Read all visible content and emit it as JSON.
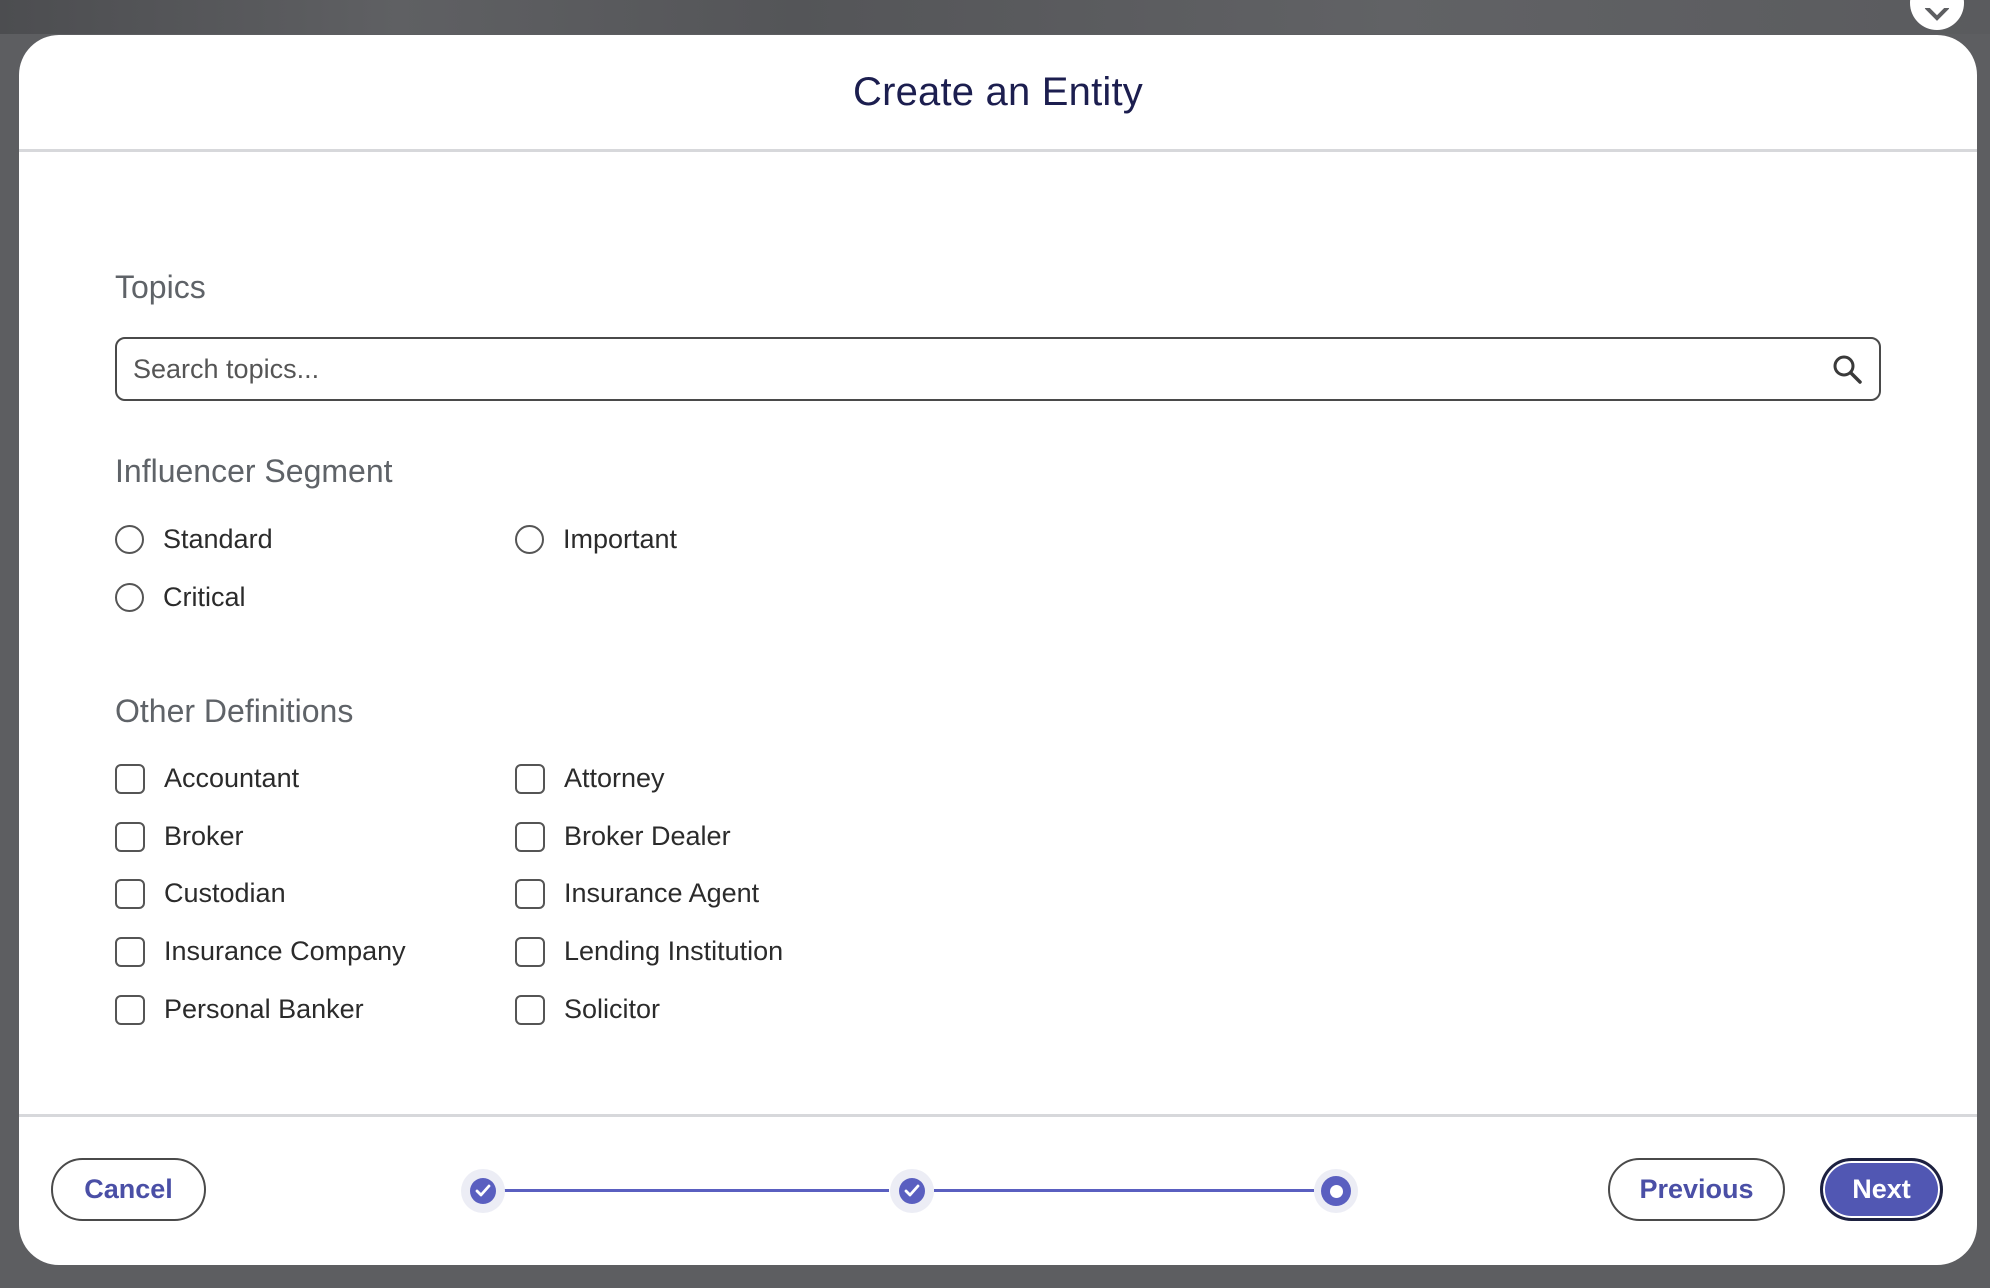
{
  "modal": {
    "title": "Create an Entity"
  },
  "topics": {
    "title": "Topics",
    "search_placeholder": "Search topics...",
    "search_value": ""
  },
  "influencer_segment": {
    "title": "Influencer Segment",
    "options": [
      {
        "label": "Standard",
        "selected": false
      },
      {
        "label": "Important",
        "selected": false
      },
      {
        "label": "Critical",
        "selected": false
      }
    ]
  },
  "other_definitions": {
    "title": "Other Definitions",
    "options": [
      {
        "label": "Accountant",
        "checked": false
      },
      {
        "label": "Attorney",
        "checked": false
      },
      {
        "label": "Broker",
        "checked": false
      },
      {
        "label": "Broker Dealer",
        "checked": false
      },
      {
        "label": "Custodian",
        "checked": false
      },
      {
        "label": "Insurance Agent",
        "checked": false
      },
      {
        "label": "Insurance Company",
        "checked": false
      },
      {
        "label": "Lending Institution",
        "checked": false
      },
      {
        "label": "Personal Banker",
        "checked": false
      },
      {
        "label": "Solicitor",
        "checked": false
      }
    ]
  },
  "footer": {
    "cancel_label": "Cancel",
    "previous_label": "Previous",
    "next_label": "Next",
    "stepper": {
      "total_steps": 3,
      "completed_steps": 2,
      "current_step": 3
    }
  },
  "icons": {
    "search": "search-icon",
    "check": "check-icon",
    "close": "close-icon"
  },
  "colors": {
    "accent": "#5157b3",
    "title": "#1c1e4f",
    "section_title": "#5f6368",
    "backdrop": "#5d5e61"
  }
}
